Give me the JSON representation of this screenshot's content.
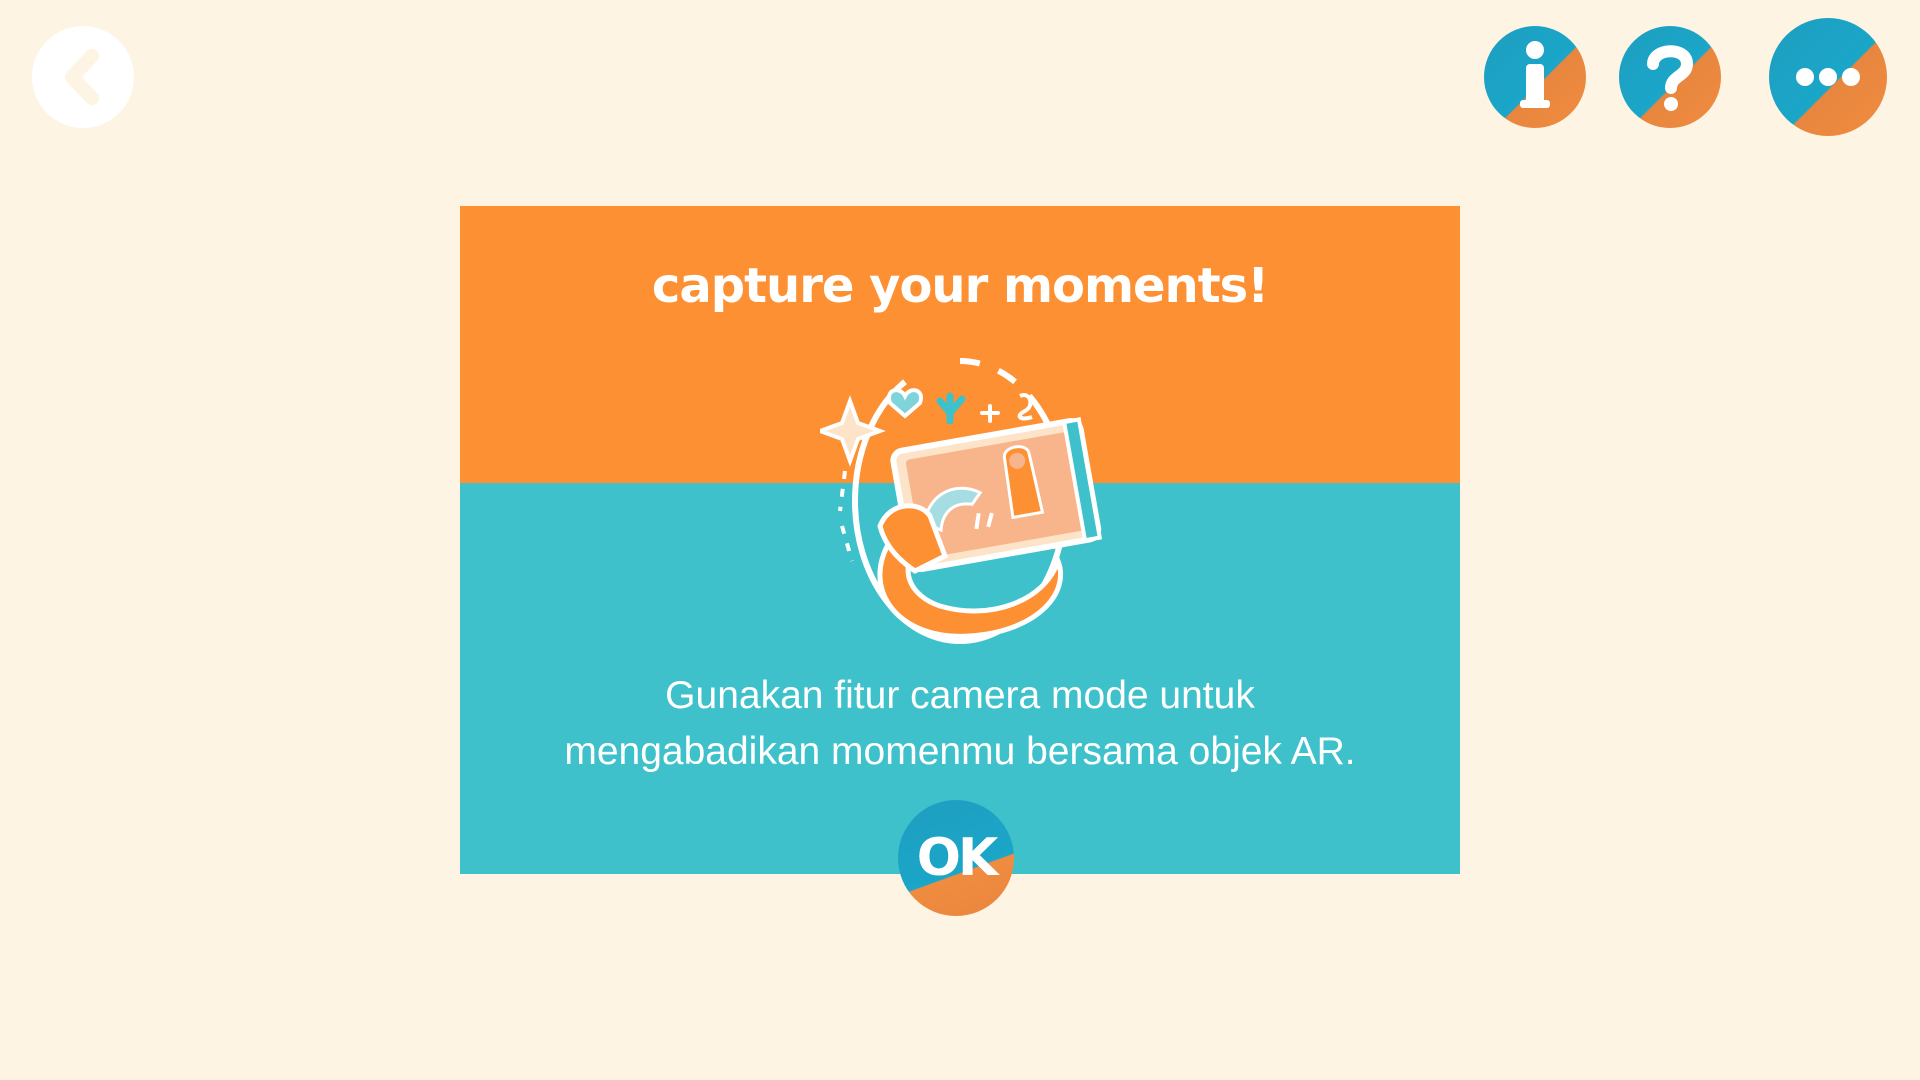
{
  "toolbar": {
    "back_icon": "chevron-left-icon",
    "info_icon": "info-icon",
    "help_icon": "question-mark-icon",
    "more_icon": "more-dots-icon"
  },
  "dialog": {
    "title": "capture your moments!",
    "illustration_icon": "camera-ar-selfie-illustration",
    "description_lines": [
      "Gunakan fitur camera mode untuk",
      "mengabadikan momenmu bersama objek AR."
    ],
    "ok_label": "OK"
  },
  "colors": {
    "background": "#fdf4e3",
    "orange": "#fd9033",
    "teal": "#3ec1cb",
    "button_blue": "#1aa6c8",
    "button_orange": "#f08c3f"
  }
}
